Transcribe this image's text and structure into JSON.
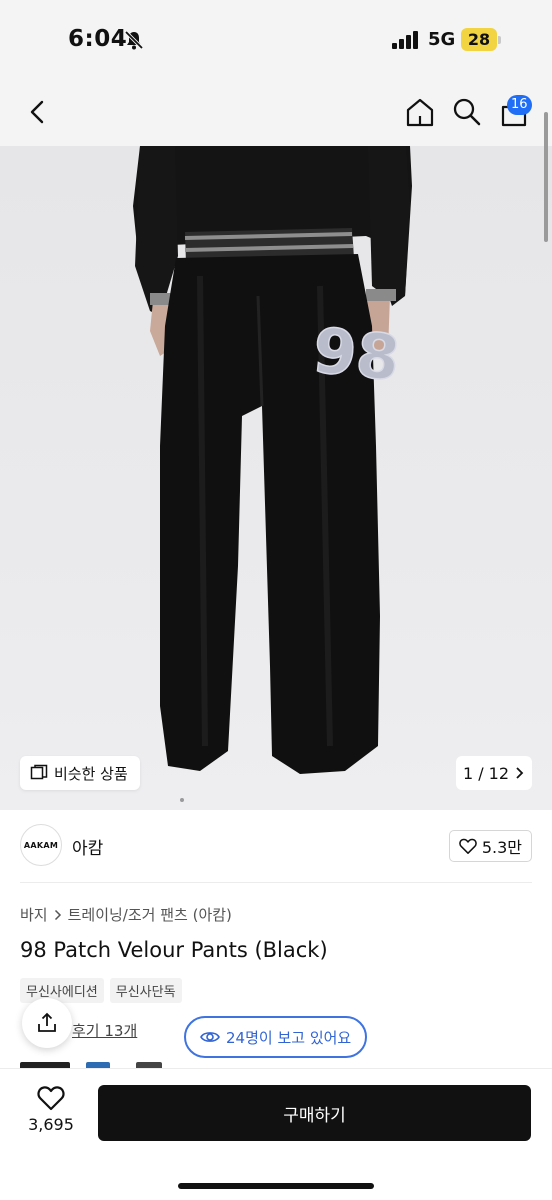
{
  "status_bar": {
    "time": "6:04",
    "network": "5G",
    "battery": "28"
  },
  "nav": {
    "cart_count": "16"
  },
  "gallery": {
    "similar_label": "비슷한 상품",
    "counter": "1 / 12",
    "patch_text": "98"
  },
  "brand": {
    "logo_text": "AAKAM",
    "name": "아캄",
    "likes": "5.3만"
  },
  "breadcrumb": {
    "category": "바지",
    "subcategory": "트레이닝/조거 팬츠 (아캄)"
  },
  "product": {
    "title": "98 Patch Velour Pants (Black)",
    "tags": [
      "무신사에디션",
      "무신사단독"
    ]
  },
  "reviews": {
    "label": "후기 13개"
  },
  "viewers": {
    "label": "24명이 보고 있어요"
  },
  "bottom_bar": {
    "wish_count": "3,695",
    "buy_label": "구매하기"
  }
}
